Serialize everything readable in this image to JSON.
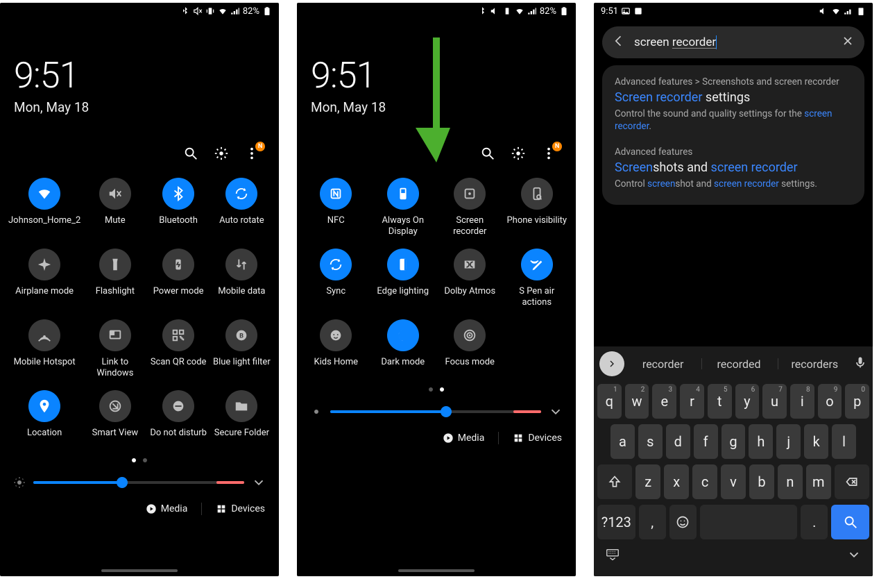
{
  "status": {
    "time": "9:51",
    "battery_pct": "82%",
    "icons": [
      "bluetooth",
      "mute",
      "vibrate",
      "wifi",
      "signal",
      "battery"
    ]
  },
  "clock": {
    "time": "9:51",
    "date": "Mon, May 18"
  },
  "qs_header_badge": "N",
  "panel1": {
    "active_dot": 0,
    "toggles": [
      {
        "label": "Johnson_Home_2",
        "state": "on",
        "icon": "wifi"
      },
      {
        "label": "Mute",
        "state": "off",
        "icon": "mute"
      },
      {
        "label": "Bluetooth",
        "state": "on",
        "icon": "bluetooth"
      },
      {
        "label": "Auto rotate",
        "state": "on",
        "icon": "autorotate"
      },
      {
        "label": "Airplane mode",
        "state": "off",
        "icon": "airplane"
      },
      {
        "label": "Flashlight",
        "state": "off",
        "icon": "flashlight"
      },
      {
        "label": "Power mode",
        "state": "off",
        "icon": "power"
      },
      {
        "label": "Mobile data",
        "state": "off",
        "icon": "mobiledata"
      },
      {
        "label": "Mobile Hotspot",
        "state": "off",
        "icon": "hotspot"
      },
      {
        "label": "Link to Windows",
        "state": "off",
        "icon": "linkwin"
      },
      {
        "label": "Scan QR code",
        "state": "off",
        "icon": "qr"
      },
      {
        "label": "Blue light filter",
        "state": "off",
        "icon": "bluelight"
      },
      {
        "label": "Location",
        "state": "on",
        "icon": "location"
      },
      {
        "label": "Smart View",
        "state": "off",
        "icon": "smartview"
      },
      {
        "label": "Do not disturb",
        "state": "off",
        "icon": "dnd"
      },
      {
        "label": "Secure Folder",
        "state": "off",
        "icon": "folder"
      }
    ],
    "brightness_pct": 42
  },
  "panel2": {
    "active_dot": 1,
    "toggles": [
      {
        "label": "NFC",
        "state": "on",
        "icon": "nfc"
      },
      {
        "label": "Always On Display",
        "state": "on",
        "icon": "aod"
      },
      {
        "label": "Screen recorder",
        "state": "off",
        "icon": "screenrec"
      },
      {
        "label": "Phone visibility",
        "state": "off",
        "icon": "phonevis"
      },
      {
        "label": "Sync",
        "state": "on",
        "icon": "sync"
      },
      {
        "label": "Edge lighting",
        "state": "on",
        "icon": "edge"
      },
      {
        "label": "Dolby Atmos",
        "state": "off",
        "icon": "dolby"
      },
      {
        "label": "S Pen air actions",
        "state": "on",
        "icon": "spen"
      },
      {
        "label": "Kids Home",
        "state": "off",
        "icon": "kids"
      },
      {
        "label": "Dark mode",
        "state": "on",
        "icon": "darkmode"
      },
      {
        "label": "Focus mode",
        "state": "off",
        "icon": "focus"
      }
    ],
    "brightness_pct": 55
  },
  "footer": {
    "media_label": "Media",
    "devices_label": "Devices"
  },
  "search_panel": {
    "status_time": "9:51",
    "query_fixed": "screen ",
    "query_underlined": "recorder",
    "results": [
      {
        "path_pre": "Advanced features > Screenshots and screen recorder",
        "title_hl": "Screen recorder",
        "title_rest": " settings",
        "desc_pre": "Control the sound and quality settings for the ",
        "desc_hl": "screen recorder",
        "desc_post": "."
      },
      {
        "path_pre": "Advanced features",
        "title_hl1": "Screen",
        "title_mid": "shots and ",
        "title_hl2": "screen recorder",
        "desc_pre": "Control ",
        "desc_hl1": "screen",
        "desc_mid": "shot and ",
        "desc_hl2": "screen recorder",
        "desc_post": " settings."
      }
    ],
    "suggestions": [
      "recorder",
      "recorded",
      "recorders"
    ],
    "keys_row1": [
      [
        "q",
        "1"
      ],
      [
        "w",
        "2"
      ],
      [
        "e",
        "3"
      ],
      [
        "r",
        "4"
      ],
      [
        "t",
        "5"
      ],
      [
        "y",
        "6"
      ],
      [
        "u",
        "7"
      ],
      [
        "i",
        "8"
      ],
      [
        "o",
        "9"
      ],
      [
        "p",
        "0"
      ]
    ],
    "keys_row2": [
      "a",
      "s",
      "d",
      "f",
      "g",
      "h",
      "j",
      "k",
      "l"
    ],
    "keys_row3": [
      "z",
      "x",
      "c",
      "v",
      "b",
      "n",
      "m"
    ],
    "sym_key": "?123",
    "comma_key": ",",
    "period_key": "."
  }
}
